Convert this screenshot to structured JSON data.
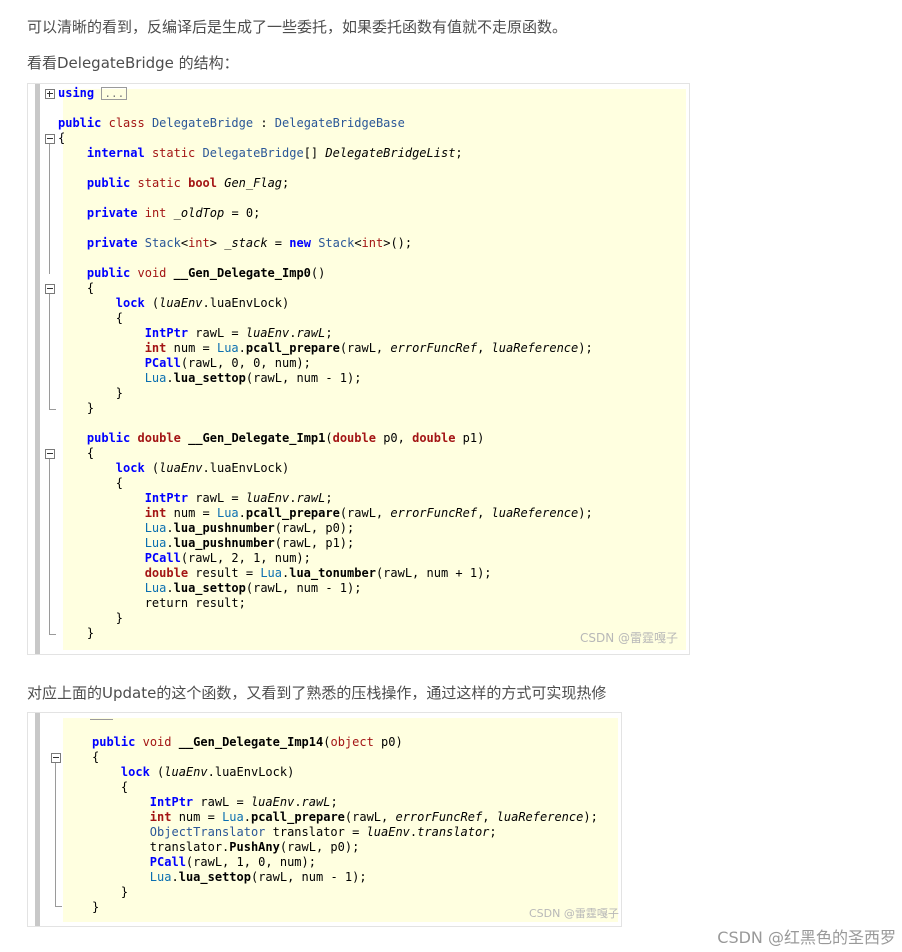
{
  "paragraphs": {
    "p1": "可以清晰的看到，反编译后是生成了一些委托，如果委托函数有值就不走原函数。",
    "p2": "看看DelegateBridge 的结构：",
    "p3": "对应上面的Update的这个函数，又看到了熟悉的压栈操作，通过这样的方式可实现热修"
  },
  "figure1": {
    "watermark": "CSDN @雷霆嘎子",
    "using_keyword": "using",
    "collapsed_label": "..."
  },
  "figure2": {
    "watermark": "CSDN @雷霆嘎子"
  },
  "page_watermark": "CSDN @红黑色的圣西罗"
}
